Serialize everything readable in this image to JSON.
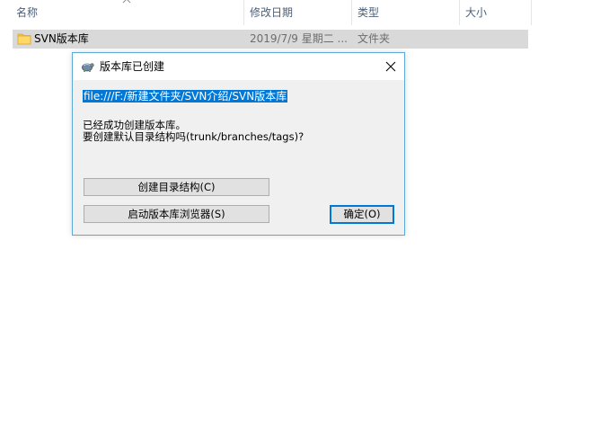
{
  "explorer": {
    "columns": {
      "name": "名称",
      "date": "修改日期",
      "type": "类型",
      "size": "大小"
    },
    "rows": [
      {
        "name": "SVN版本库",
        "date": "2019/7/9 星期二 ...",
        "type": "文件夹",
        "size": ""
      }
    ]
  },
  "dialog": {
    "title": "版本库已创建",
    "path": "file:///F:/新建文件夹/SVN介绍/SVN版本库",
    "message_line1": "已经成功创建版本库。",
    "message_line2": "要创建默认目录结构吗(trunk/branches/tags)?",
    "create_structure_button": "创建目录结构(C)",
    "browse_repo_button": "启动版本库浏览器(S)",
    "ok_button": "确定(O)"
  },
  "colors": {
    "dialog_border": "#5aa9d6",
    "selection": "#0078d7",
    "row_selected": "#d9d9d9",
    "folder": "#f6c44b"
  }
}
